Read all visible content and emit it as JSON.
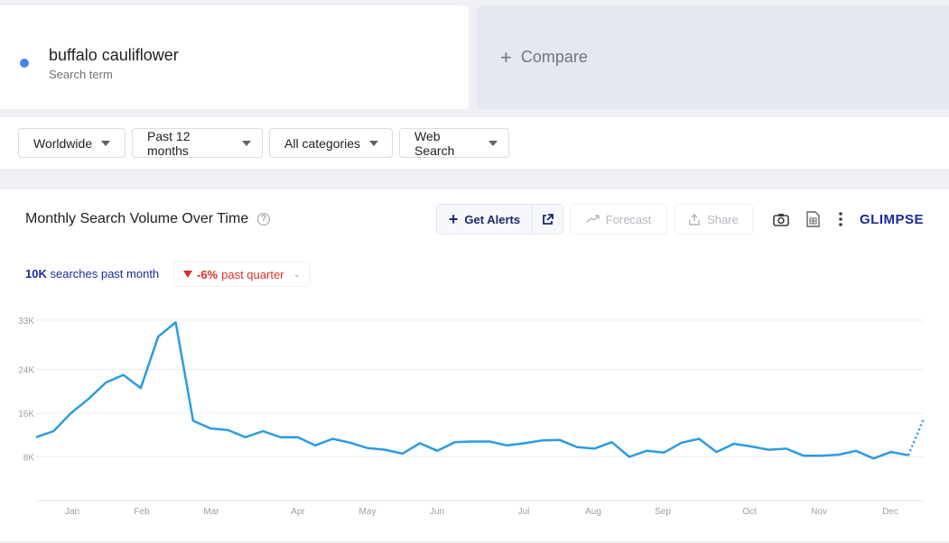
{
  "search_term": {
    "name": "buffalo cauliflower",
    "sublabel": "Search term",
    "color": "#4285f4"
  },
  "compare": {
    "label": "Compare",
    "icon": "plus-icon"
  },
  "filters": [
    {
      "label": "Worldwide"
    },
    {
      "label": "Past 12 months"
    },
    {
      "label": "All categories"
    },
    {
      "label": "Web Search"
    }
  ],
  "chart_panel": {
    "title": "Monthly Search Volume Over Time",
    "help_icon": "question-circle-icon",
    "toolbar": {
      "alerts_label": "Get Alerts",
      "external_link_icon": "external-link-icon",
      "forecast_label": "Forecast",
      "forecast_icon": "trend-up-icon",
      "share_label": "Share",
      "share_icon": "share-icon",
      "camera_icon": "camera-icon",
      "csv_icon": "csv-file-icon",
      "more_icon": "more-vert-icon",
      "brand": "GLIMPSE"
    },
    "stats": {
      "volume_value": "10K",
      "volume_text": "searches past month",
      "change_value": "-6%",
      "change_text": "past quarter",
      "change_color": "#d93025"
    }
  },
  "chart_data": {
    "type": "line",
    "title": "Monthly Search Volume Over Time",
    "xlabel": "",
    "ylabel": "",
    "y_ticks": [
      "8K",
      "16K",
      "24K",
      "33K"
    ],
    "y_tick_values": [
      8000,
      16000,
      24000,
      33000
    ],
    "ylim": [
      0,
      33000
    ],
    "x_tick_labels": [
      "Jan",
      "Feb",
      "Mar",
      "Apr",
      "May",
      "Jun",
      "Jul",
      "Aug",
      "Sep",
      "Oct",
      "Nov",
      "Dec"
    ],
    "grid": true,
    "series": [
      {
        "values": [
          11600,
          12700,
          16000,
          18600,
          21600,
          23000,
          20600,
          30000,
          32600,
          14600,
          13200,
          12900,
          11600,
          12700,
          11600,
          11600,
          10100,
          11300,
          10600,
          9600,
          9300,
          8600,
          10500,
          9100,
          10700,
          10800,
          10800,
          10100,
          10500,
          11000,
          11100,
          9800,
          9500,
          10700,
          8000,
          9100,
          8800,
          10600,
          11300,
          8900,
          10400,
          9900,
          9300,
          9500,
          8200,
          8200,
          8400,
          9100,
          7700,
          8900,
          8300
        ],
        "forecast_values": [
          8300,
          15000
        ],
        "color": "#2b9be3"
      }
    ]
  }
}
